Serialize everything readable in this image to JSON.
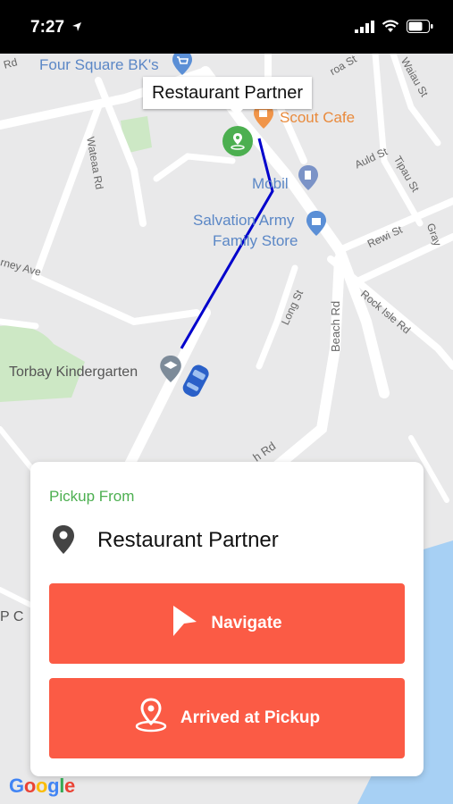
{
  "status": {
    "time": "7:27"
  },
  "map": {
    "labels": {
      "four_square": "Four Square BK's",
      "scout_cafe": "Scout Cafe",
      "mobil": "Mobil",
      "salvation_line1": "Salvation Army",
      "salvation_line2": "Family Store",
      "torbay_kg": "Torbay Kindergarten",
      "wateaa_rd": "Wateaa Rd",
      "auld_st": "Auld St",
      "tipau_st": "Tipau St",
      "rewi_st": "Rewi St",
      "gray": "Gray",
      "waiau_st": "Waiau St",
      "rock_isle_rd": "Rock Isle Rd",
      "beach_rd": "Beach Rd",
      "long_st": "Long St",
      "rney_ave": "rney Ave",
      "h_rd": "h Rd",
      "roa_st": "roa St",
      "rd_top": "Rd",
      "p_c": "P C"
    },
    "tooltip": "Restaurant Partner"
  },
  "card": {
    "pickup_label": "Pickup From",
    "pickup_name": "Restaurant Partner",
    "navigate_label": "Navigate",
    "arrived_label": "Arrived at Pickup"
  },
  "google": {
    "g1": "G",
    "o1": "o",
    "o2": "o",
    "g2": "g",
    "l": "l",
    "e": "e"
  },
  "colors": {
    "accent": "#fb5b45",
    "pickup_green": "#4caf50",
    "route_blue": "#0000cc"
  }
}
